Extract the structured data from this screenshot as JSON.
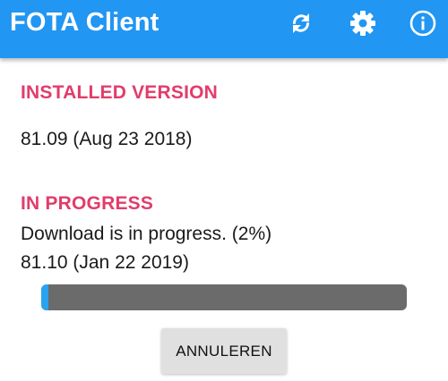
{
  "app_bar": {
    "title": "FOTA Client",
    "background_color": "#2196f3",
    "icons": [
      "sync-icon",
      "gear-icon",
      "info-icon"
    ]
  },
  "installed": {
    "heading": "INSTALLED VERSION",
    "version": "81.09 (Aug 23 2018)"
  },
  "progress": {
    "heading": "IN PROGRESS",
    "status": "Download is in progress. (2%)",
    "version": "81.10 (Jan 22 2019)",
    "percent": 2,
    "fill_color": "#29a3f0",
    "track_color": "#6b6b6b"
  },
  "actions": {
    "cancel_label": "ANNULEREN"
  },
  "colors": {
    "heading_accent": "#e23c6b"
  }
}
